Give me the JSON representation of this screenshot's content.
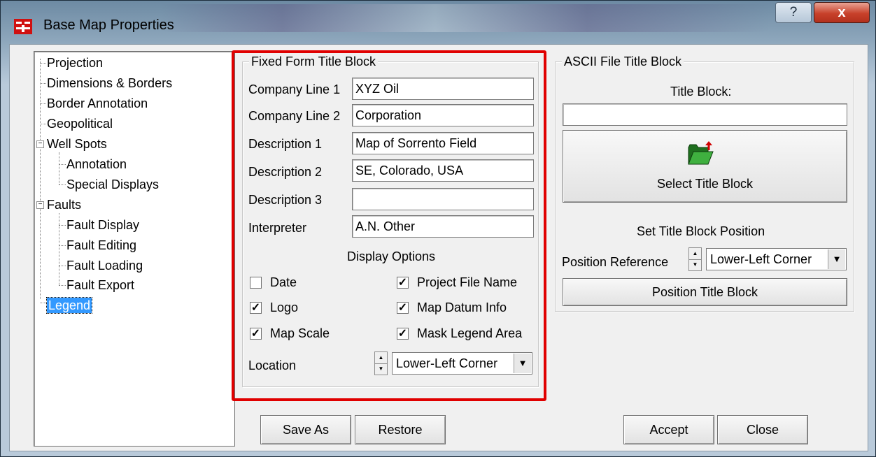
{
  "window": {
    "title": "Base Map Properties",
    "help_label": "?",
    "close_label": "x"
  },
  "tree": {
    "items": [
      {
        "label": "Projection"
      },
      {
        "label": "Dimensions & Borders"
      },
      {
        "label": "Border Annotation"
      },
      {
        "label": "Geopolitical"
      },
      {
        "label": "Well Spots"
      },
      {
        "label": "Annotation"
      },
      {
        "label": "Special Displays"
      },
      {
        "label": "Faults"
      },
      {
        "label": "Fault Display"
      },
      {
        "label": "Fault Editing"
      },
      {
        "label": "Fault Loading"
      },
      {
        "label": "Fault Export"
      },
      {
        "label": "Legend"
      }
    ],
    "selected": "Legend"
  },
  "fixed": {
    "title": "Fixed Form Title Block",
    "company1_label": "Company Line 1",
    "company1_value": "XYZ Oil",
    "company2_label": "Company Line 2",
    "company2_value": "Corporation",
    "desc1_label": "Description 1",
    "desc1_value": "Map of Sorrento Field",
    "desc2_label": "Description 2",
    "desc2_value": "SE, Colorado, USA",
    "desc3_label": "Description 3",
    "desc3_value": "",
    "interp_label": "Interpreter",
    "interp_value": "A.N. Other",
    "display_options": "Display Options",
    "date_label": "Date",
    "logo_label": "Logo",
    "mapscale_label": "Map Scale",
    "projfile_label": "Project File Name",
    "datum_label": "Map Datum Info",
    "mask_label": "Mask Legend Area",
    "checks": {
      "date": false,
      "logo": true,
      "mapscale": true,
      "projfile": true,
      "datum": true,
      "mask": true
    },
    "location_label": "Location",
    "location_value": "Lower-Left Corner"
  },
  "ascii": {
    "title": "ASCII File Title Block",
    "title_block_label": "Title Block:",
    "title_block_value": "",
    "select_label": "Select Title Block",
    "set_position": "Set Title Block Position",
    "position_ref_label": "Position Reference",
    "position_ref_value": "Lower-Left Corner",
    "position_button": "Position Title Block"
  },
  "footer": {
    "save_as": "Save As",
    "restore": "Restore",
    "accept": "Accept",
    "close": "Close"
  },
  "colors": {
    "highlight": "#e00000",
    "selection": "#3399ff",
    "folder": "#2d8b2d"
  }
}
